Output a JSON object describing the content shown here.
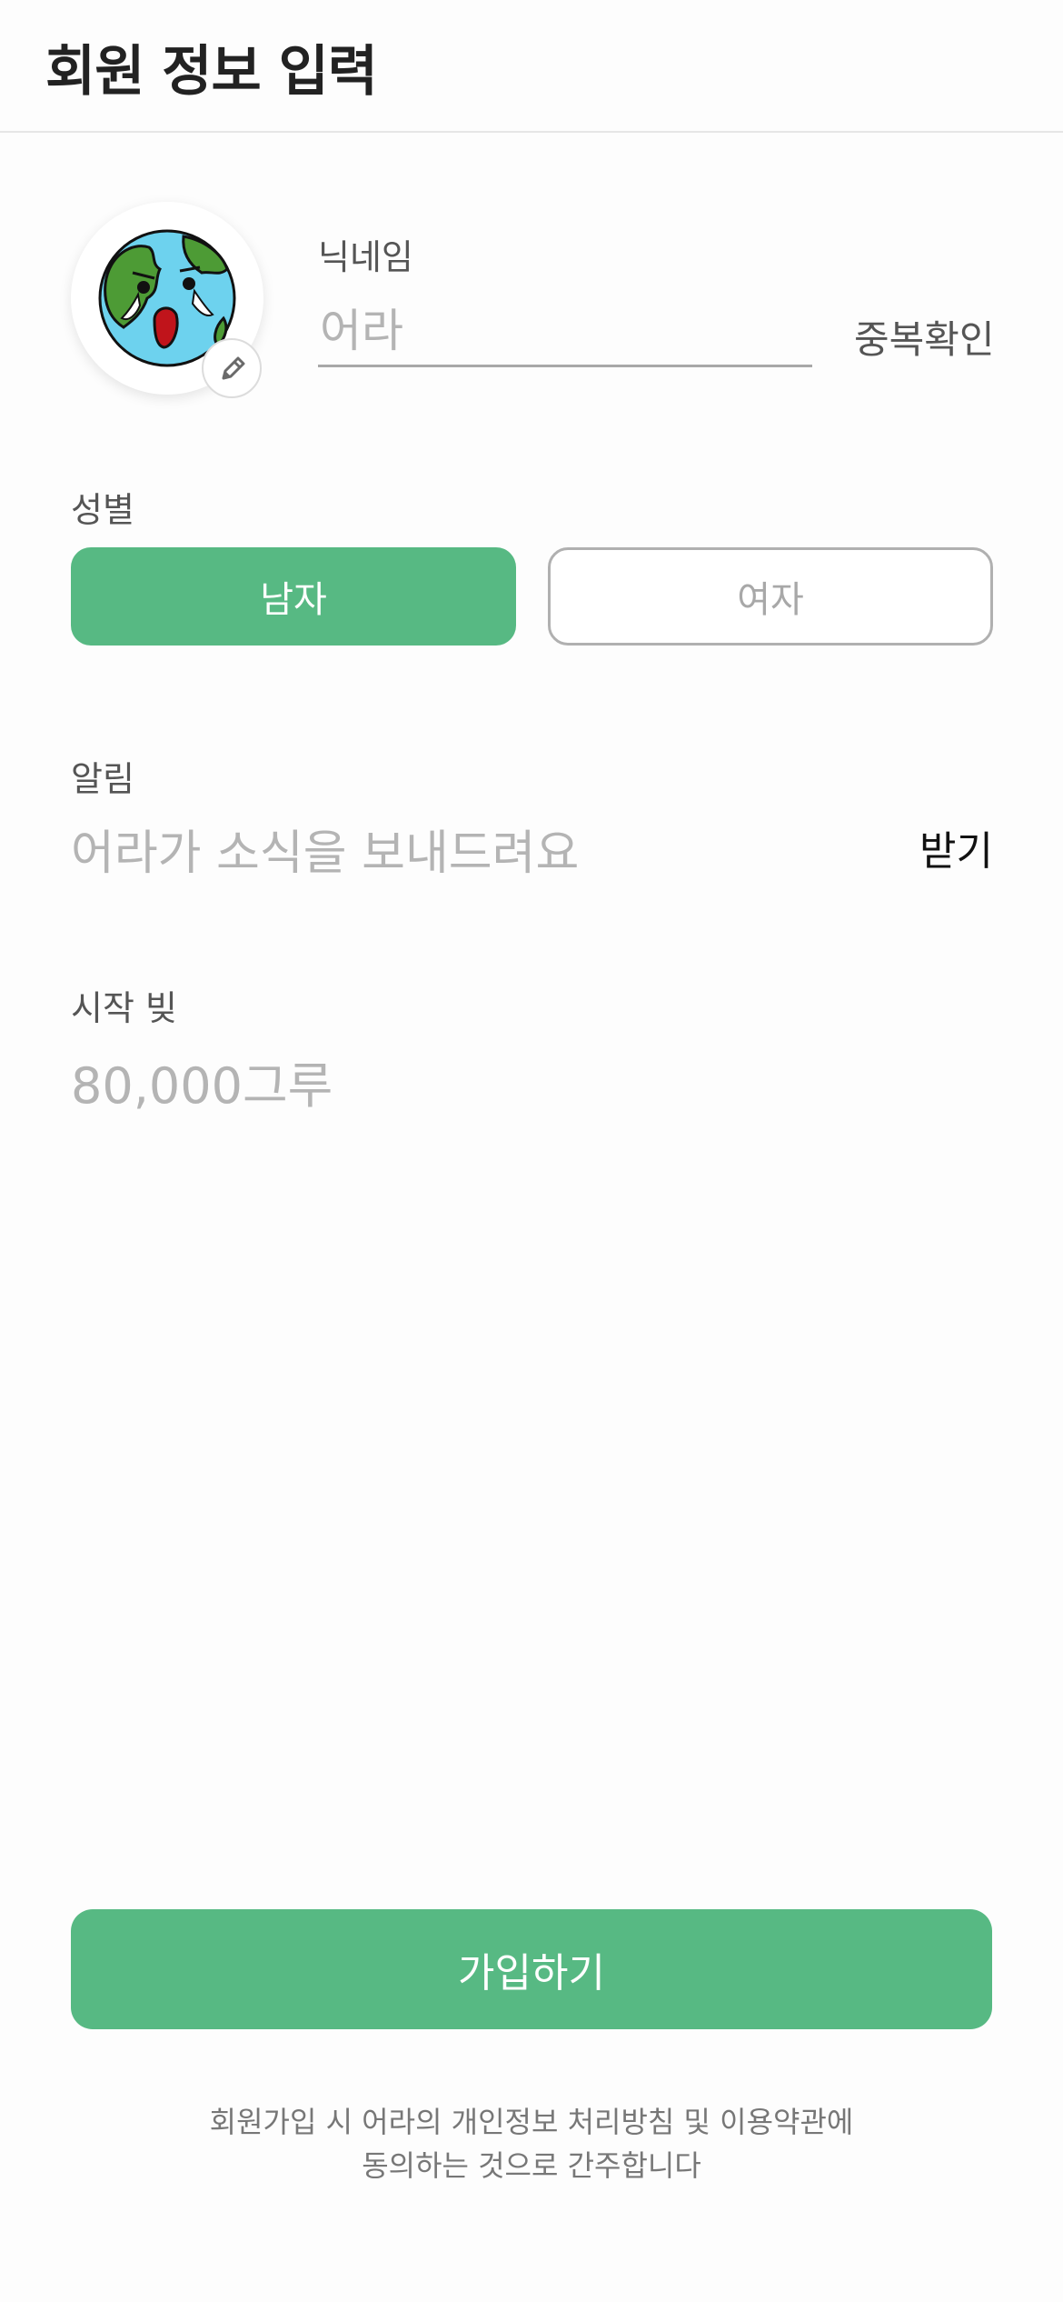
{
  "header": {
    "title": "회원 정보 입력"
  },
  "profile": {
    "avatar_icon": "crying-earth-icon",
    "edit_icon": "pencil-icon"
  },
  "nickname": {
    "label": "닉네임",
    "placeholder": "어라",
    "value": "",
    "check_button": "중복확인"
  },
  "gender": {
    "label": "성별",
    "options": [
      "남자",
      "여자"
    ],
    "selected": "남자"
  },
  "notification": {
    "label": "알림",
    "text": "어라가 소식을 보내드려요",
    "toggle_label": "받기"
  },
  "start_debt": {
    "label": "시작 빚",
    "value": "80,000그루"
  },
  "signup": {
    "button": "가입하기",
    "terms_line1": "회원가입 시 어라의 개인정보 처리방침 및 이용약관에",
    "terms_line2": "동의하는 것으로 간주합니다"
  },
  "colors": {
    "accent": "#57b983",
    "muted": "#b4b4b4",
    "label": "#555555"
  }
}
